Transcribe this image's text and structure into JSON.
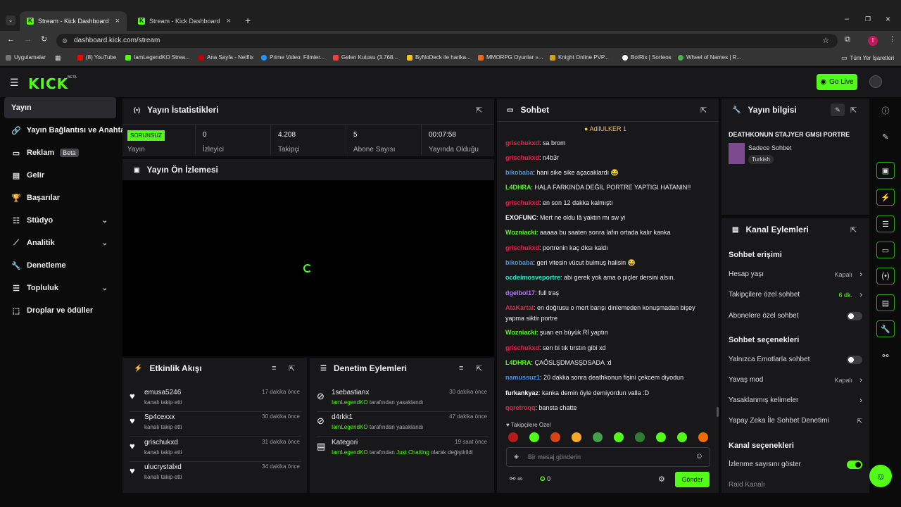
{
  "browser": {
    "tabs": [
      {
        "title": "Stream - Kick Dashboard"
      },
      {
        "title": "Stream - Kick Dashboard"
      }
    ],
    "url": "dashboard.kick.com/stream",
    "bookmarks": [
      "Uygulamalar",
      "(8) YouTube",
      "IamLegendKO Strea...",
      "Ana Sayfa - Netflix",
      "Prime Video: Filmler...",
      "Gelen Kutusu (3.768...",
      "ByNoDeck ile harika...",
      "MMORPG Oyunlar »...",
      "Knight Online PVP...",
      "BotRix | Sorteos",
      "Wheel of Names | R...",
      "Tüm Yer İşaretleri"
    ],
    "profile_letter": "I"
  },
  "header": {
    "logo": "KICK",
    "beta": "BETA",
    "go_live": "Go Live"
  },
  "sidebar": {
    "items": [
      {
        "label": "Yayın"
      },
      {
        "label": "Yayın Bağlantısı ve Anahtar"
      },
      {
        "label": "Reklam",
        "badge": "Beta"
      },
      {
        "label": "Gelir"
      },
      {
        "label": "Başarılar"
      },
      {
        "label": "Stüdyo"
      },
      {
        "label": "Analitik"
      },
      {
        "label": "Denetleme"
      },
      {
        "label": "Topluluk"
      },
      {
        "label": "Droplar ve ödüller"
      }
    ]
  },
  "stats": {
    "title": "Yayın İstatistikleri",
    "status": "SORUNSUZ",
    "status_label": "Yayın",
    "cells": [
      {
        "value": "0",
        "label": "İzleyici"
      },
      {
        "value": "4.208",
        "label": "Takipçi"
      },
      {
        "value": "5",
        "label": "Abone Sayısı"
      },
      {
        "value": "00:07:58",
        "label": "Yayında Olduğu"
      }
    ]
  },
  "preview": {
    "title": "Yayın Ön İzlemesi"
  },
  "activity": {
    "title": "Etkinlik Akışı",
    "items": [
      {
        "name": "emusa5246",
        "sub": "kanalı takip etti",
        "time": "17 dakika önce"
      },
      {
        "name": "Sp4cexxx",
        "sub": "kanalı takip etti",
        "time": "30 dakika önce"
      },
      {
        "name": "grischukxd",
        "sub": "kanalı takip etti",
        "time": "31 dakika önce"
      },
      {
        "name": "ulucrystalxd",
        "sub": "kanalı takip etti",
        "time": "34 dakika önce"
      }
    ]
  },
  "moderation": {
    "title": "Denetim Eylemleri",
    "items": [
      {
        "name": "1sebastianx",
        "actor": "IamLegendKO",
        "sub": "tarafından yasaklandı",
        "time": "30 dakika önce"
      },
      {
        "name": "d4rkk1",
        "actor": "IamLegendKO",
        "sub": "tarafından yasaklandı",
        "time": "47 dakika önce"
      },
      {
        "name": "Kategori",
        "actor": "IamLegendKO",
        "sub": "tarafından",
        "category": "Just Chatting",
        "sub2": "olarak değiştirildi",
        "time": "19 saat önce"
      }
    ]
  },
  "chat": {
    "title": "Sohbet",
    "pinned_user": "AdilULKER",
    "pinned_count": "1",
    "messages": [
      {
        "user": "grischukxd",
        "color": "#e0264c",
        "text": "sa brom"
      },
      {
        "user": "grischukxd",
        "color": "#e0264c",
        "text": "n4b3r"
      },
      {
        "user": "bikobaba",
        "color": "#4a90e2",
        "text": "hani sike sike açacaklardı 😂"
      },
      {
        "user": "L4DHRA",
        "color": "#53fc18",
        "text": "HALA FARKINDA DEĞİL PORTRE YAPTIGI HATANIN!!"
      },
      {
        "user": "grischukxd",
        "color": "#e0264c",
        "text": "en son 12 dakka kalmıştı"
      },
      {
        "user": "EXOFUNC",
        "color": "#ffffff",
        "text": "Mert ne oldu lâ yaktın mı sw yi"
      },
      {
        "user": "Wozniacki",
        "color": "#53fc18",
        "text": "aaaaa bu saaten sonra lafın ortada kalır kanka"
      },
      {
        "user": "grischukxd",
        "color": "#e0264c",
        "text": "portrenin kaç dksı kaldı"
      },
      {
        "user": "bikobaba",
        "color": "#4a90e2",
        "text": "geri vitesin vücut bulmuş halisin 😂"
      },
      {
        "user": "ocdeimosveportre",
        "color": "#2ee6c8",
        "text": "abi gerek yok ama o piçler dersini alsın."
      },
      {
        "user": "dgelbol17",
        "color": "#b37af0",
        "text": "full traş"
      },
      {
        "user": "AtaKartal",
        "color": "#e0264c",
        "text": "en doğrusu o mert barışı dinlemeden konuşmadan bişey yapma siktir portre"
      },
      {
        "user": "Wozniacki",
        "color": "#53fc18",
        "text": "şuan en büyük Rİ yaptın"
      },
      {
        "user": "grischukxd",
        "color": "#e0264c",
        "text": "sen bi tık tırstın gibi xd"
      },
      {
        "user": "L4DHRA",
        "color": "#53fc18",
        "text": "ÇAÖSLŞDMASŞDSADA :d"
      },
      {
        "user": "namussuz1",
        "color": "#4a90e2",
        "text": "20 dakka sonra deathkonun fişini çekcem diyodun"
      },
      {
        "user": "furkankyaz",
        "color": "#ffffff",
        "text": "kanka demin öyle demiyordun valla :D"
      },
      {
        "user": "qqretroqq",
        "color": "#e0264c",
        "text": "bansta chatte"
      }
    ],
    "followers_only": "Takipçilere Özel",
    "input_placeholder": "Bir mesaj gönderin",
    "infinity": "∞",
    "count": "0",
    "send": "Gönder"
  },
  "info": {
    "title": "Yayın bilgisi",
    "stream_title": "DEATHKONUN STAJYER GMSI PORTRE",
    "category": "Sadece Sohbet",
    "language": "Turkish"
  },
  "actions": {
    "title": "Kanal Eylemleri",
    "chat_access": "Sohbet erişimi",
    "account_age": "Hesap yaşı",
    "account_age_val": "Kapalı",
    "followers_chat": "Takipçilere özel sohbet",
    "followers_chat_val": "6 dk.",
    "subs_chat": "Abonelere özel sohbet",
    "chat_options": "Sohbet seçenekleri",
    "emote_only": "Yalnızca Emotlarla sohbet",
    "slow_mode": "Yavaş mod",
    "slow_mode_val": "Kapalı",
    "banned_words": "Yasaklanmış kelimeler",
    "ai_mod": "Yapay Zeka İle Sohbet Denetimi",
    "channel_options": "Kanal seçenekleri",
    "show_viewers": "İzlenme sayısını göster",
    "raid": "Raid Kanalı"
  }
}
